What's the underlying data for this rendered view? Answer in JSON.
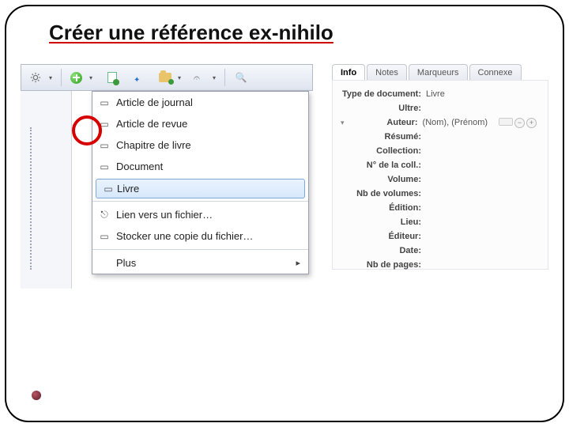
{
  "title": "Créer une référence ex-nihilo",
  "toolbar": {
    "gear": "gear",
    "add": "add",
    "doc": "doc",
    "wand": "wand",
    "folder": "folder",
    "clip": "clip",
    "mag": "mag"
  },
  "dropdown": {
    "items": [
      {
        "label": "Article de journal",
        "icon": ""
      },
      {
        "label": "Article de revue",
        "icon": ""
      },
      {
        "label": "Chapitre de livre",
        "icon": ""
      },
      {
        "label": "Document",
        "icon": ""
      },
      {
        "label": "Livre",
        "icon": "",
        "highlight": true
      }
    ],
    "link_item": "Lien vers un fichier…",
    "store_item": "Stocker une copie du fichier…",
    "more_item": "Plus"
  },
  "tabs": [
    "Info",
    "Notes",
    "Marqueurs",
    "Connexe"
  ],
  "panel": {
    "type_label": "Type de document:",
    "type_value": "Livre",
    "fields": [
      {
        "label": "Ultre:",
        "value": ""
      },
      {
        "label": "Auteur:",
        "value": "(Nom), (Prénom)",
        "author": true
      },
      {
        "label": "Résumé:",
        "value": ""
      },
      {
        "label": "Collection:",
        "value": ""
      },
      {
        "label": "N° de la coll.:",
        "value": ""
      },
      {
        "label": "Volume:",
        "value": ""
      },
      {
        "label": "Nb de volumes:",
        "value": ""
      },
      {
        "label": "Édition:",
        "value": ""
      },
      {
        "label": "Lieu:",
        "value": ""
      },
      {
        "label": "Éditeur:",
        "value": ""
      },
      {
        "label": "Date:",
        "value": ""
      },
      {
        "label": "Nb de pages:",
        "value": ""
      }
    ]
  }
}
